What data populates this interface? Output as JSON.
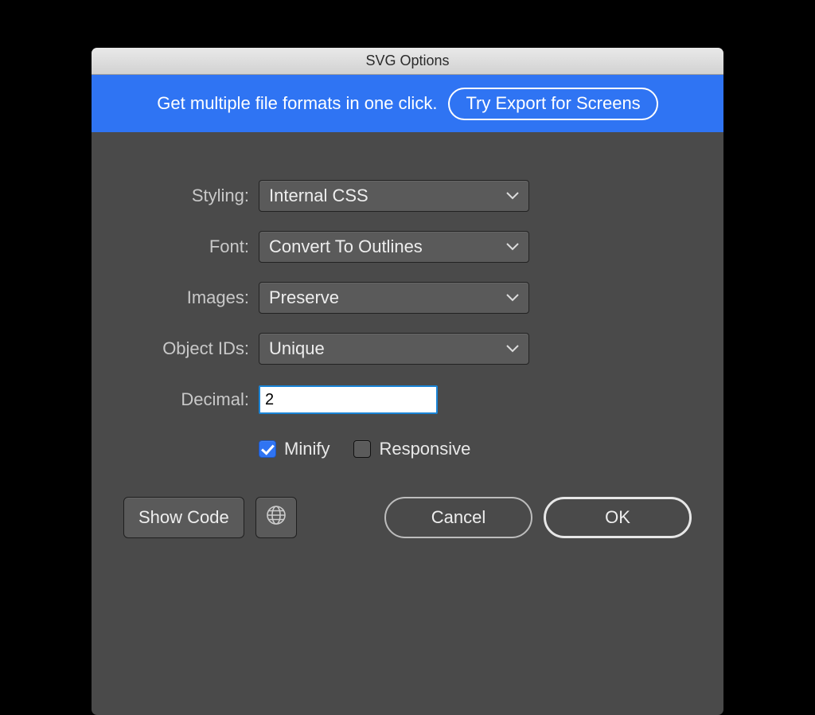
{
  "title": "SVG Options",
  "banner": {
    "text": "Get multiple file formats in one click.",
    "cta": "Try Export for Screens"
  },
  "labels": {
    "styling": "Styling:",
    "font": "Font:",
    "images": "Images:",
    "objectIds": "Object IDs:",
    "decimal": "Decimal:"
  },
  "values": {
    "styling": "Internal CSS",
    "font": "Convert To Outlines",
    "images": "Preserve",
    "objectIds": "Unique",
    "decimal": "2"
  },
  "checkboxes": {
    "minify": {
      "label": "Minify",
      "checked": true
    },
    "responsive": {
      "label": "Responsive",
      "checked": false
    }
  },
  "buttons": {
    "showCode": "Show Code",
    "cancel": "Cancel",
    "ok": "OK"
  }
}
